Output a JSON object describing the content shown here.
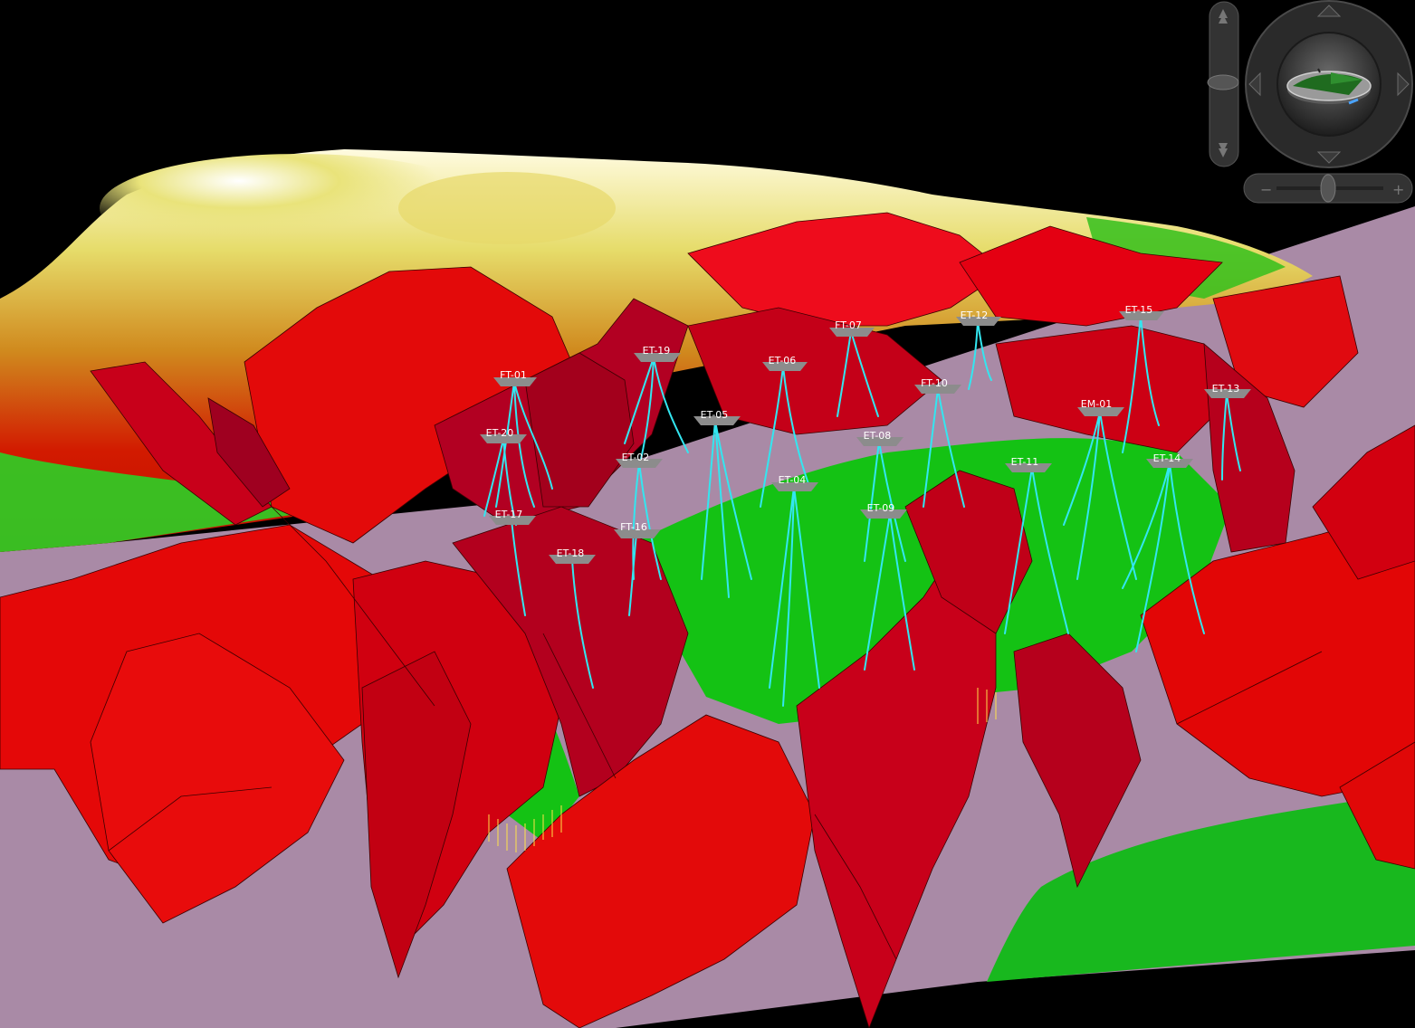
{
  "colors": {
    "background": "#000000",
    "base_plane": "#a98aa6",
    "fault": "#e10000",
    "fault_dark": "#a8001e",
    "fault_edge": "#3a0000",
    "reservoir": "#12c21a",
    "well_path": "#33e6f0",
    "platform": "#8c8c8c",
    "terrain_high": "#fff3a0",
    "terrain_low": "#cc1a00"
  },
  "wells": [
    {
      "label": "FT-01"
    },
    {
      "label": "ET-19"
    },
    {
      "label": "ET-06"
    },
    {
      "label": "FT-07"
    },
    {
      "label": "ET-12"
    },
    {
      "label": "ET-15"
    },
    {
      "label": "ET-20"
    },
    {
      "label": "ET-05"
    },
    {
      "label": "FT-10"
    },
    {
      "label": "EM-01"
    },
    {
      "label": "ET-13"
    },
    {
      "label": "ET-02"
    },
    {
      "label": "ET-08"
    },
    {
      "label": "ET-11"
    },
    {
      "label": "ET-14"
    },
    {
      "label": "ET-04"
    },
    {
      "label": "ET-09"
    },
    {
      "label": "ET-17"
    },
    {
      "label": "FT-16"
    },
    {
      "label": "ET-18"
    }
  ],
  "navigation": {
    "icons": [
      "tilt-up-arrow-icon",
      "tilt-down-arrow-icon",
      "pan-up-arrow-icon",
      "pan-down-arrow-icon",
      "pan-left-arrow-icon",
      "pan-right-arrow-icon",
      "compass-icon",
      "zoom-out-icon",
      "zoom-in-icon"
    ],
    "zoom_out": "−",
    "zoom_in": "+"
  }
}
